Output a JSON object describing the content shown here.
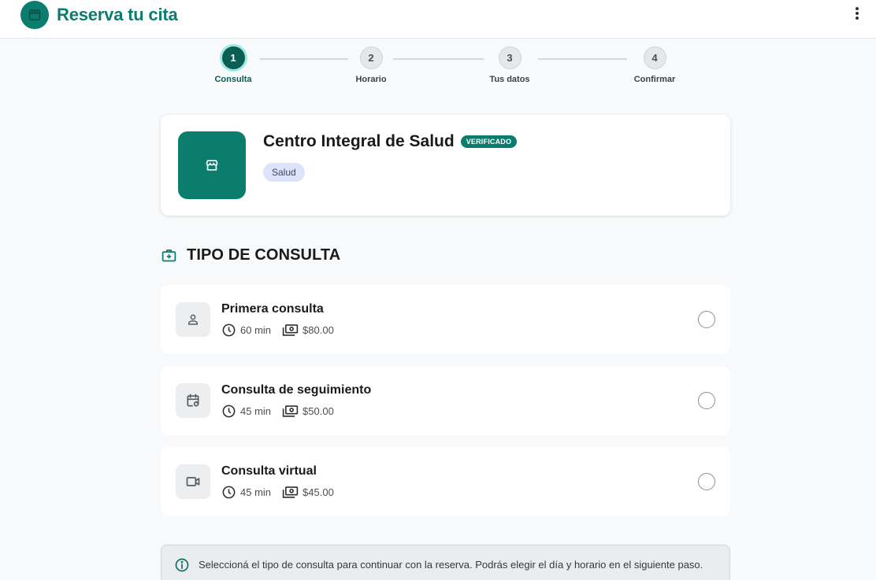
{
  "app": {
    "title": "Reserva tu cita",
    "brand_color": "#0b7d6f"
  },
  "stepper": {
    "steps": [
      {
        "number": "1",
        "label": "Consulta",
        "state": "active"
      },
      {
        "number": "2",
        "label": "Horario",
        "state": "pending"
      },
      {
        "number": "3",
        "label": "Tus datos",
        "state": "pending"
      },
      {
        "number": "4",
        "label": "Confirmar",
        "state": "pending"
      }
    ]
  },
  "center": {
    "name": "Centro Integral de Salud",
    "verified_badge": "VERIFICADO",
    "category": "Salud",
    "logo_icon": "storefront-icon"
  },
  "section": {
    "title": "TIPO DE CONSULTA",
    "icon": "medical-bag-icon"
  },
  "consultations": [
    {
      "name": "Primera consulta",
      "duration": "60 min",
      "price": "$80.00",
      "icon": "person-icon",
      "selected": false
    },
    {
      "name": "Consulta de seguimiento",
      "duration": "45 min",
      "price": "$50.00",
      "icon": "calendar-repeat-icon",
      "selected": false
    },
    {
      "name": "Consulta virtual",
      "duration": "45 min",
      "price": "$45.00",
      "icon": "video-camera-icon",
      "selected": false
    }
  ],
  "info": {
    "text": "Seleccioná el tipo de consulta para continuar con la reserva. Podrás elegir el día y horario en el siguiente paso.",
    "icon": "info-icon"
  }
}
